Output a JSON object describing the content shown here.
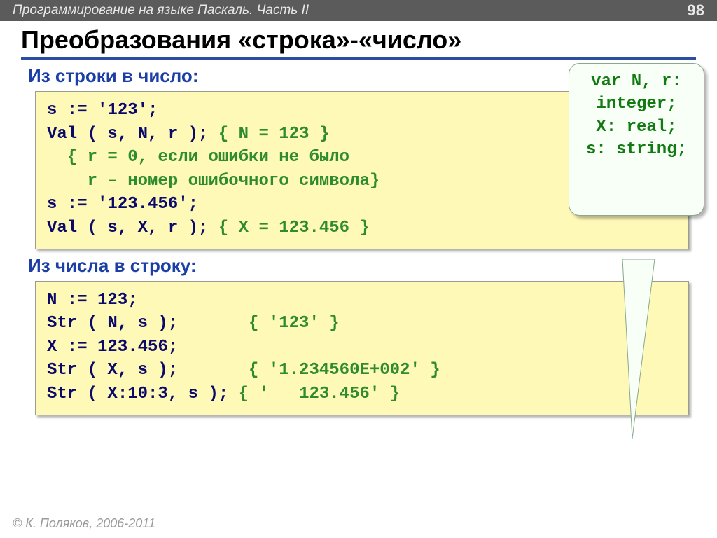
{
  "header": {
    "breadcrumb": "Программирование на языке Паскаль. Часть II",
    "page": "98"
  },
  "title": "Преобразования «строка»-«число»",
  "section1": {
    "heading": "Из строки в число:",
    "l1a": "s := '123';",
    "l2a": "Val ( s, N, r ); ",
    "l2b": "{ N = 123 }",
    "l3": "  { r = 0, если ошибки не было",
    "l4": "    r – номер ошибочного символа}",
    "l5a": "s := '123.456';",
    "l6a": "Val ( s, X, r ); ",
    "l6b": "{ X = 123.456 }"
  },
  "section2": {
    "heading": "Из числа в строку:",
    "l1a": "N := 123;",
    "l2a": "Str ( N, s );       ",
    "l2b": "{ '123' }",
    "l3a": "X := 123.456;",
    "l4a": "Str ( X, s );       ",
    "l4b": "{ '1.234560E+002' }",
    "l5a": "Str ( X:10:3, s ); ",
    "l5b": "{ '   123.456' }"
  },
  "callout": {
    "l1": "var N, r:",
    "l2": "integer;",
    "l3": "X: real;",
    "l4": "s: string;"
  },
  "footer": "© К. Поляков, 2006-2011"
}
